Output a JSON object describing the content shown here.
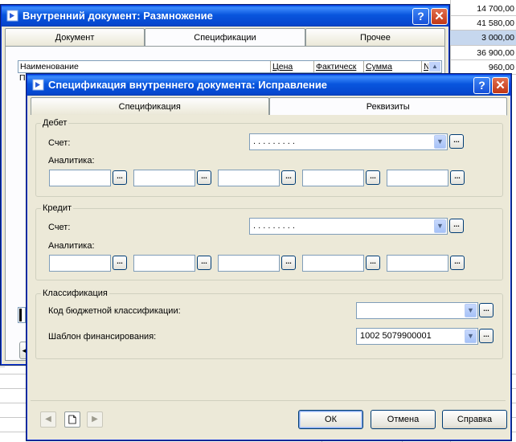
{
  "spreadsheet": {
    "amounts": [
      "14 700,00",
      "41 580,00",
      "3 000,00",
      "36 900,00",
      "960,00"
    ],
    "selected_index": 2
  },
  "bg_window": {
    "title": "Внутренний документ: Размножение",
    "tabs": [
      "Документ",
      "Спецификации",
      "Прочее"
    ],
    "active_tab": 1,
    "columns": [
      "Наименование",
      "Цена",
      "Фактическ",
      "Сумма",
      "№"
    ],
    "first_cell": "П"
  },
  "dialog": {
    "title": "Спецификация внутреннего документа: Исправление",
    "tabs": [
      "Спецификация",
      "Реквизиты"
    ],
    "active_tab": 1,
    "debit": {
      "legend": "Дебет",
      "account_label": "Счет:",
      "account_value": ". . . . . . . . .",
      "analytics_label": "Аналитика:"
    },
    "credit": {
      "legend": "Кредит",
      "account_label": "Счет:",
      "account_value": ". . . . . . . . .",
      "analytics_label": "Аналитика:"
    },
    "classification": {
      "legend": "Классификация",
      "budget_code_label": "Код бюджетной классификации:",
      "budget_code_value": "",
      "funding_template_label": "Шаблон финансирования:",
      "funding_template_value": "1002 5079900001"
    },
    "buttons": {
      "ok": "ОК",
      "cancel": "Отмена",
      "help": "Справка"
    },
    "ellipsis": "..."
  },
  "colors": {
    "title_bar": "#0855dd",
    "window_face": "#ece9d8",
    "selection": "#c6d7ee"
  }
}
